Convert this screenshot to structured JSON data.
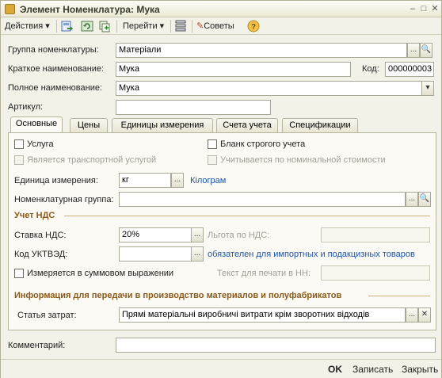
{
  "window": {
    "title": "Элемент Номенклатура: Мука"
  },
  "toolbar": {
    "actions_label": "Действия",
    "goto_label": "Перейти",
    "tips_label": "Советы"
  },
  "fields": {
    "group_label": "Группа номенклатуры:",
    "group_value": "Матеріали",
    "short_name_label": "Краткое наименование:",
    "short_name_value": "Мука",
    "code_label": "Код:",
    "code_value": "000000003",
    "full_name_label": "Полное наименование:",
    "full_name_value": "Мука",
    "article_label": "Артикул:",
    "article_value": "",
    "comment_label": "Комментарий:",
    "comment_value": ""
  },
  "tabs": [
    {
      "label": "Основные",
      "active": true
    },
    {
      "label": "Цены",
      "active": false
    },
    {
      "label": "Единицы измерения",
      "active": false
    },
    {
      "label": "Счета учета",
      "active": false
    },
    {
      "label": "Спецификации",
      "active": false
    }
  ],
  "main_tab": {
    "service_label": "Услуга",
    "service_checked": false,
    "strict_blank_label": "Бланк строгого учета",
    "strict_blank_checked": false,
    "transport_label": "Является транспортной услугой",
    "nominal_label": "Учитывается по номинальной стоимости",
    "unit_label": "Единица измерения:",
    "unit_value": "кг",
    "unit_link": "Кілограм",
    "nom_group_label": "Номенклатурная группа:",
    "nom_group_value": "",
    "vat_section": "Учет НДС",
    "vat_rate_label": "Ставка НДС:",
    "vat_rate_value": "20%",
    "vat_benefit_label": "Льгота по НДС:",
    "vat_benefit_value": "",
    "uktved_label": "Код УКТВЭД:",
    "uktved_value": "",
    "uktved_link": "обязателен для импортных и подакцизных товаров",
    "sum_label": "Измеряется в суммовом выражении",
    "sum_checked": false,
    "print_text_label": "Текст для печати в НН:",
    "print_text_value": "",
    "prod_section": "Информация для передачи в производство материалов и полуфабрикатов",
    "cost_item_label": "Статья затрат:",
    "cost_item_value": "Прямі матеріальні виробничі витрати крім зворотних відходів"
  },
  "footer": {
    "ok_label": "OK",
    "save_label": "Записать",
    "close_label": "Закрыть"
  }
}
